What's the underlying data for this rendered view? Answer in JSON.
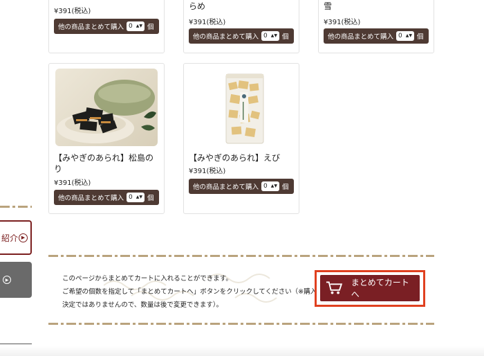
{
  "top_row": {
    "items": [
      {
        "name_tail": "",
        "price": "¥391(税込)"
      },
      {
        "name_tail": "らめ",
        "price": "¥391(税込)"
      },
      {
        "name_tail": "雪",
        "price": "¥391(税込)"
      }
    ]
  },
  "bulk_label": "他の商品まとめて購入",
  "bulk_qty": "0",
  "bulk_unit": "個",
  "products": [
    {
      "name_line1": "【みやぎのあられ】松島のり",
      "name_line2": "",
      "price": "¥391(税込)"
    },
    {
      "name_line1": "【みやぎのあられ】えび",
      "name_line2": "",
      "price": "¥391(税込)"
    }
  ],
  "sidebar": {
    "outline_label": "紹介",
    "outline_icon": "arrow-circle-icon",
    "gray_icon": "arrow-circle-icon"
  },
  "info_text": {
    "line1": "このページからまとめてカートに入れることができます。",
    "line2": "ご希望の個数を指定して「まとめてカートへ」ボタンをクリックしてください（※購入",
    "line3": "決定ではありませんので、数量は後で変更できます）。"
  },
  "cart_button": {
    "label": "まとめてカートへ",
    "icon": "cart-icon"
  },
  "colors": {
    "bulk_bg": "#4e3a33",
    "cart_bg": "#7a1f24",
    "highlight": "#e0401f",
    "accent": "#7b1f1f"
  }
}
